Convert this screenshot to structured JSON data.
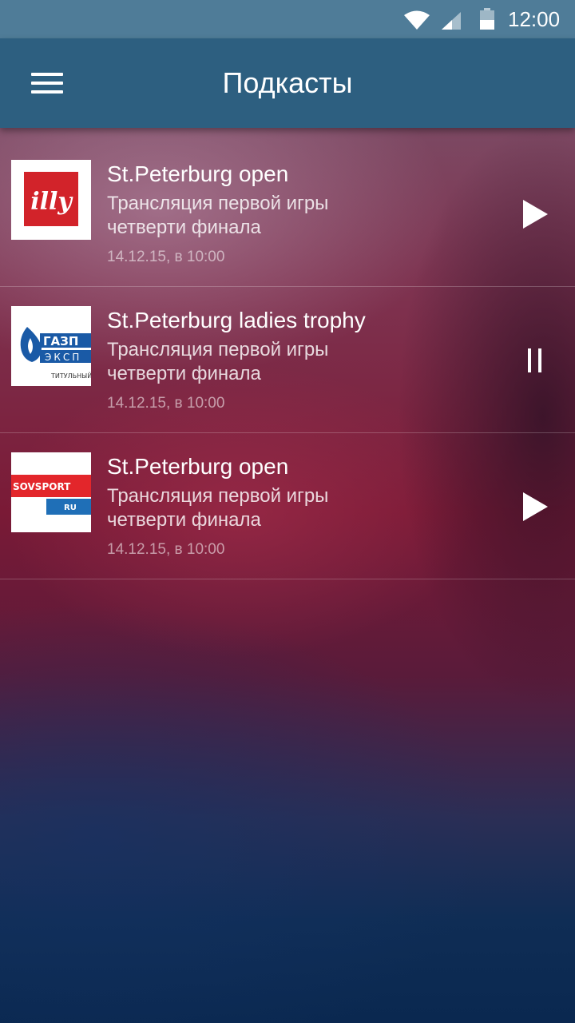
{
  "status_bar": {
    "time": "12:00",
    "icons": [
      "wifi-icon",
      "signal-icon",
      "battery-icon"
    ]
  },
  "app_bar": {
    "title": "Подкасты",
    "menu_icon": "hamburger-menu-icon"
  },
  "podcasts": [
    {
      "title": "St.Peterburg open",
      "desc_line1": "Трансляция первой игры",
      "desc_line2": "четверти финала",
      "date": "14.12.15, в 10:00",
      "logo": "illy-logo",
      "logo_text": "illy",
      "control": "play-icon"
    },
    {
      "title": "St.Peterburg ladies trophy",
      "desc_line1": "Трансляция первой игры",
      "desc_line2": "четверти финала",
      "date": "14.12.15, в 10:00",
      "logo": "gazprom-export-logo",
      "logo_text": "ГАЗП ЭКСП ТИТУЛЬНЫЙ",
      "control": "pause-icon"
    },
    {
      "title": "St.Peterburg open",
      "desc_line1": "Трансляция первой игры",
      "desc_line2": "четверти финала",
      "date": "14.12.15, в 10:00",
      "logo": "sovsport-logo",
      "logo_text": "SOVSPORT RU",
      "control": "play-icon"
    }
  ],
  "colors": {
    "status_bar": "#4f7c98",
    "app_bar": "#2d5f80",
    "illy_red": "#d2232a",
    "gazprom_blue": "#1a5aa6",
    "sovsport_red": "#e3262b",
    "sovsport_blue": "#1f6fb7"
  }
}
